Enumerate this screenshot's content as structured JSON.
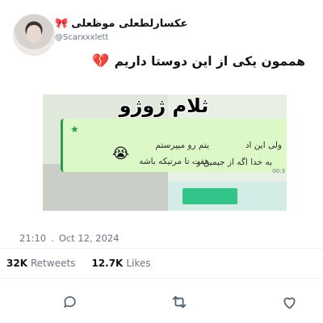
{
  "header": {
    "display_name": "عکسارلطعلی موظعلی",
    "handle": "@Scarxxxlett",
    "bow_icon": "bow-icon"
  },
  "tweet": {
    "text": "هممون یکی از این دوستا داریم",
    "emoji": "💔"
  },
  "media": {
    "title": "ثلام ژوژو",
    "left_line1": "یتم رو میپرستم",
    "left_line2": "هفت تا مرتیکه باشه",
    "right_line1": "ولی این اد",
    "right_line2": "به خدا اگه از جیمین و",
    "time_text": "00:3",
    "emoji": "😭",
    "star": "★"
  },
  "meta": {
    "time": "21:10",
    "sep": ".",
    "date": "Oct 12, 2024"
  },
  "stats": {
    "retweets_count": "32K",
    "retweets_label": "Retweets",
    "likes_count": "12.7K",
    "likes_label": "Likes"
  },
  "actions": [
    "reply-icon",
    "retweet-icon",
    "like-icon"
  ],
  "colors": {
    "secondary_text": "#6b7580",
    "primary_text": "#0f1419",
    "chat_bubble": "#dcf8c6",
    "accent_green": "#2e9a4b"
  }
}
